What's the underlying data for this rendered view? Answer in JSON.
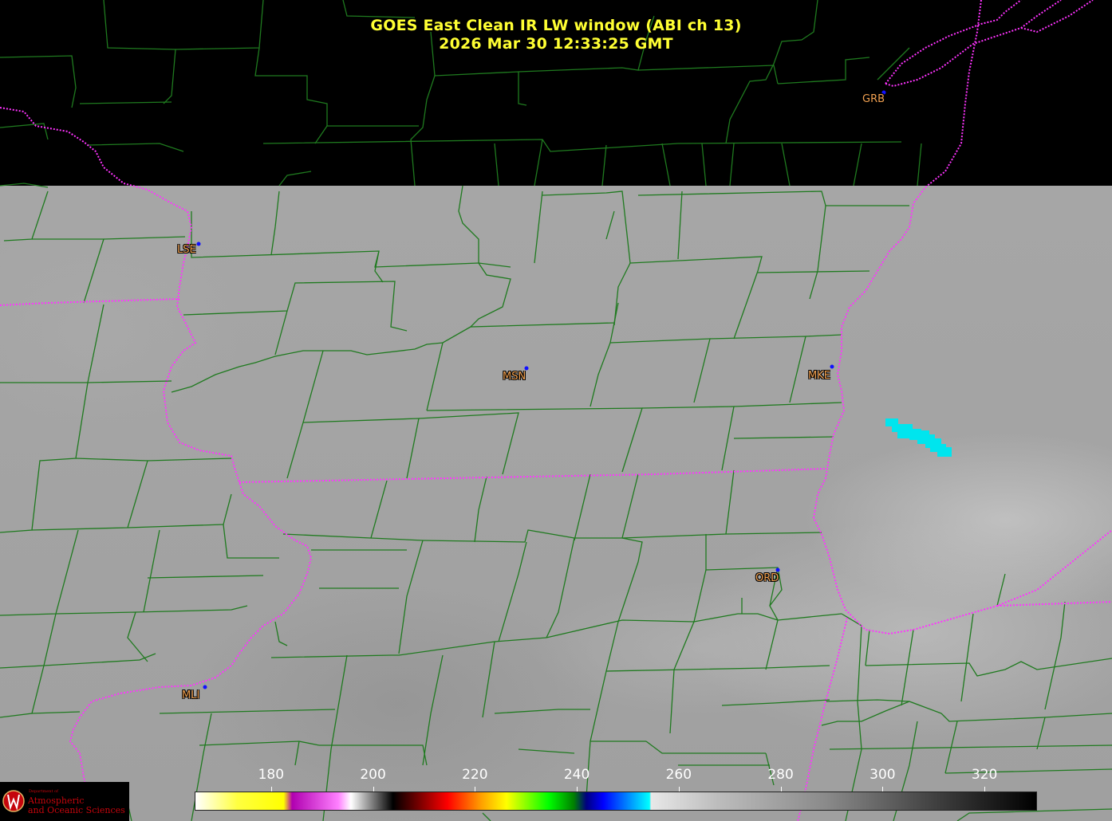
{
  "title": {
    "line1": "GOES East Clean IR LW window (ABI ch 13)",
    "line2": "2026 Mar 30  12:33:25 GMT"
  },
  "stations": [
    {
      "id": "GRB",
      "name": "GRB"
    },
    {
      "id": "LSE",
      "name": "LSE"
    },
    {
      "id": "MSN",
      "name": "MSN"
    },
    {
      "id": "MKE",
      "name": "MKE"
    },
    {
      "id": "ORD",
      "name": "ORD"
    },
    {
      "id": "MLI",
      "name": "MLI"
    }
  ],
  "colorbar": {
    "ticks": [
      "180",
      "200",
      "220",
      "240",
      "260",
      "280",
      "300",
      "320"
    ],
    "range": [
      165,
      330
    ]
  },
  "logo": {
    "dept_small": "Department of",
    "line1": "Atmospheric",
    "line2": "and Oceanic Sciences"
  },
  "colors": {
    "title": "#ffff33",
    "county_borders": "#1f7a1f",
    "state_borders": "#ff33ff",
    "station_label": "#f0a050",
    "station_dot": "#1010ff",
    "cold_cloud": "#00e5ee"
  }
}
